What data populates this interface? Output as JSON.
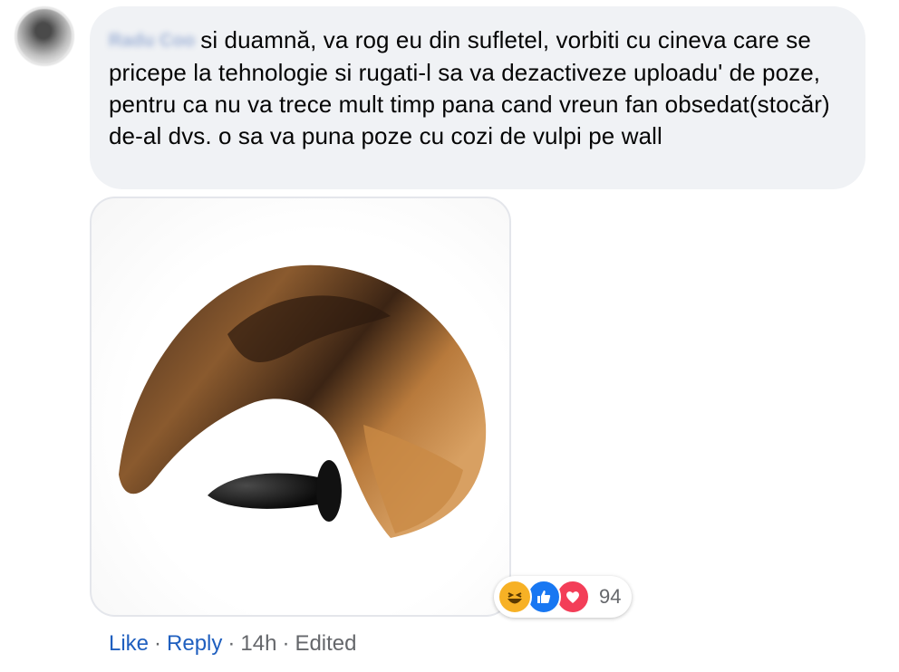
{
  "comment": {
    "author": "Radu Coo",
    "text": "si duamnă, va rog eu din sufletel, vorbiti cu cineva care se pricepe la tehnologie si rugati-l sa va dezactiveze uploadu' de poze, pentru ca nu va trece mult timp pana cand vreun fan obsedat(stocăr) de-al dvs. o sa va puna poze cu cozi de vulpi pe wall"
  },
  "attachment": {
    "icon": "photo-fox-tail"
  },
  "reactions": {
    "icons": [
      "haha-icon",
      "like-icon",
      "love-icon"
    ],
    "count": "94",
    "colors": {
      "haha": "#f7b125",
      "like": "#1877f2",
      "love": "#f33e58"
    }
  },
  "actions": {
    "like": "Like",
    "reply": "Reply",
    "separator": "·",
    "time": "14h",
    "edited": "Edited"
  },
  "colors": {
    "link": "#1f5fbf",
    "meta": "#65676b",
    "bubble": "#f0f2f5"
  }
}
